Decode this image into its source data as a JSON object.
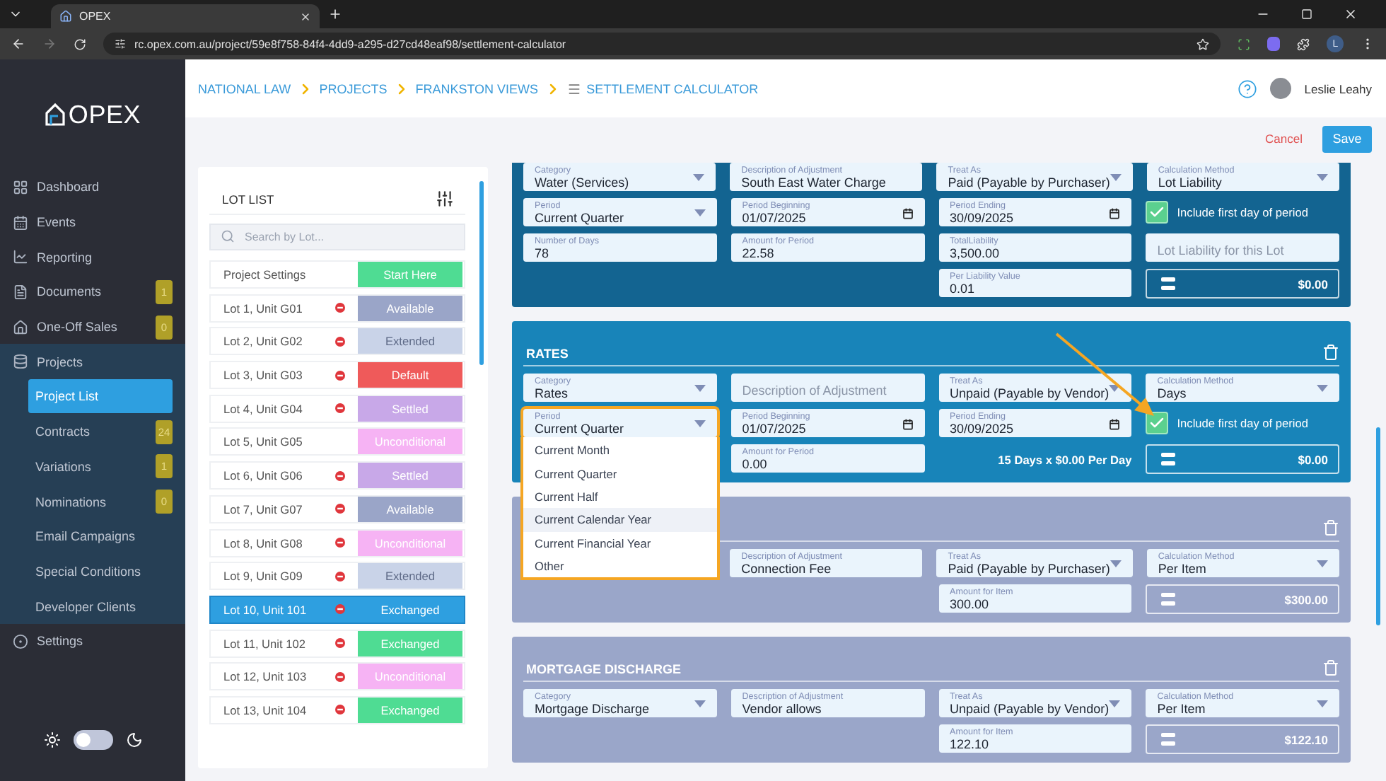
{
  "browser": {
    "tab_title": "OPEX",
    "url": "rc.opex.com.au/project/59e8f758-84f4-4dd9-a295-d27cd48eaf98/settlement-calculator",
    "profile_initial": "L",
    "forward_disabled": true
  },
  "sidebar": {
    "logo": "OPEX",
    "nav": [
      {
        "label": "Dashboard"
      },
      {
        "label": "Events"
      },
      {
        "label": "Reporting"
      },
      {
        "label": "Documents",
        "badge": "1"
      },
      {
        "label": "One-Off Sales",
        "badge": "0"
      },
      {
        "label": "Projects",
        "expanded": true,
        "children": [
          {
            "label": "Project List",
            "selected": true
          },
          {
            "label": "Contracts",
            "badge": "24",
            "selected": false
          },
          {
            "label": "Variations",
            "badge": "1",
            "selected": false
          },
          {
            "label": "Nominations",
            "badge": "0",
            "selected": false
          },
          {
            "label": "Email Campaigns",
            "selected": false
          },
          {
            "label": "Special Conditions",
            "selected": false
          },
          {
            "label": "Developer Clients",
            "selected": false
          }
        ]
      },
      {
        "label": "Settings"
      }
    ],
    "dark_mode": false
  },
  "header": {
    "breadcrumb": [
      "NATIONAL LAW",
      "PROJECTS",
      "FRANKSTON VIEWS",
      "SETTLEMENT CALCULATOR"
    ],
    "user": "Leslie Leahy"
  },
  "actions": {
    "cancel": "Cancel",
    "save": "Save"
  },
  "lot_list": {
    "title": "LOT LIST",
    "search": {
      "placeholder": "Search by Lot..."
    },
    "rows": [
      {
        "label": "Project Settings",
        "status": "Start Here",
        "color": "#4fdc93",
        "removable": false,
        "selected": false
      },
      {
        "label": "Lot 1, Unit G01",
        "status": "Available",
        "color": "#9aa5c8",
        "removable": true,
        "selected": false
      },
      {
        "label": "Lot 2, Unit G02",
        "status": "Extended",
        "color": "#c9d3e8",
        "removable": true,
        "selected": false
      },
      {
        "label": "Lot 3, Unit G03",
        "status": "Default",
        "color": "#ef5a5a",
        "removable": true,
        "selected": false
      },
      {
        "label": "Lot 4, Unit G04",
        "status": "Settled",
        "color": "#c8a8e8",
        "removable": true,
        "selected": false
      },
      {
        "label": "Lot 5, Unit G05",
        "status": "Unconditional",
        "color": "#f6b3f4",
        "removable": false,
        "selected": false
      },
      {
        "label": "Lot 6, Unit G06",
        "status": "Settled",
        "color": "#c8a8e8",
        "removable": true,
        "selected": false
      },
      {
        "label": "Lot 7, Unit G07",
        "status": "Available",
        "color": "#9aa5c8",
        "removable": true,
        "selected": false
      },
      {
        "label": "Lot 8, Unit G08",
        "status": "Unconditional",
        "color": "#f6b3f4",
        "removable": true,
        "selected": false
      },
      {
        "label": "Lot 9, Unit G09",
        "status": "Extended",
        "color": "#c9d3e8",
        "removable": true,
        "selected": false
      },
      {
        "label": "Lot 10, Unit 101",
        "status": "Exchanged",
        "color": "#2e9fe0",
        "removable": true,
        "selected": true
      },
      {
        "label": "Lot 11, Unit 102",
        "status": "Exchanged",
        "color": "#4fdc93",
        "removable": true,
        "selected": false
      },
      {
        "label": "Lot 12, Unit 103",
        "status": "Unconditional",
        "color": "#f6b3f4",
        "removable": true,
        "selected": false
      },
      {
        "label": "Lot 13, Unit 104",
        "status": "Exchanged",
        "color": "#4fdc93",
        "removable": true,
        "selected": false
      }
    ]
  },
  "panels": [
    {
      "color": "#136491",
      "deletable": false,
      "rows": [
        [
          {
            "kind": "select",
            "label": "Category",
            "value": "Water (Services)",
            "expanded": false
          },
          {
            "kind": "text",
            "label": "Description of Adjustment",
            "value": "South East Water Charge"
          },
          {
            "kind": "select",
            "label": "Treat As",
            "value": "Paid (Payable by Purchaser)",
            "expanded": false
          },
          {
            "kind": "select",
            "label": "Calculation Method",
            "value": "Lot Liability",
            "expanded": false
          }
        ],
        [
          {
            "kind": "select",
            "label": "Period",
            "value": "Current Quarter",
            "expanded": false
          },
          {
            "kind": "date",
            "label": "Period Beginning",
            "value": "01/07/2025"
          },
          {
            "kind": "date",
            "label": "Period Ending",
            "value": "30/09/2025"
          },
          {
            "kind": "checkbox",
            "label": "Include first day of period",
            "checked": true
          }
        ],
        [
          {
            "kind": "text",
            "label": "Number of Days",
            "value": "78"
          },
          {
            "kind": "text",
            "label": "Amount for Period",
            "value": "22.58"
          },
          {
            "kind": "text",
            "label": "TotalLiability",
            "value": "3,500.00"
          },
          {
            "kind": "placeholder",
            "placeholder": "Lot Liability for this Lot"
          }
        ],
        [
          "",
          "",
          {
            "kind": "text",
            "label": "Per Liability Value",
            "value": "0.01"
          },
          {
            "kind": "total",
            "value": "$0.00"
          }
        ]
      ]
    },
    {
      "color": "#1884b9",
      "title": "RATES",
      "deletable": true,
      "rows": [
        [
          {
            "kind": "select",
            "label": "Category",
            "value": "Rates",
            "expanded": false
          },
          {
            "kind": "placeholder",
            "placeholder": "Description of Adjustment"
          },
          {
            "kind": "select",
            "label": "Treat As",
            "value": "Unpaid (Payable by Vendor)",
            "expanded": false
          },
          {
            "kind": "select",
            "label": "Calculation Method",
            "value": "Days",
            "expanded": false
          }
        ],
        [
          {
            "kind": "select",
            "label": "Period",
            "value": "Current Quarter",
            "expanded": true,
            "options": [
              {
                "label": "Current Month",
                "highlighted": false
              },
              {
                "label": "Current Quarter",
                "highlighted": false
              },
              {
                "label": "Current Half",
                "highlighted": false
              },
              {
                "label": "Current Calendar Year",
                "highlighted": true
              },
              {
                "label": "Current Financial Year",
                "highlighted": false
              },
              {
                "label": "Other",
                "highlighted": false
              }
            ]
          },
          {
            "kind": "date",
            "label": "Period Beginning",
            "value": "01/07/2025"
          },
          {
            "kind": "date",
            "label": "Period Ending",
            "value": "30/09/2025"
          },
          {
            "kind": "checkbox",
            "label": "Include first day of period",
            "checked": true
          }
        ],
        [
          "",
          {
            "kind": "text",
            "label": "Amount for Period",
            "value": "0.00"
          },
          {
            "kind": "note",
            "text": "15 Days x $0.00 Per Day"
          },
          {
            "kind": "total",
            "value": "$0.00"
          }
        ]
      ]
    },
    {
      "color": "#9aa6c9",
      "deletable": true,
      "rows": [
        [
          "",
          {
            "kind": "text",
            "label": "Description of Adjustment",
            "value": "Connection Fee"
          },
          {
            "kind": "select",
            "label": "Treat As",
            "value": "Paid (Payable by Purchaser)",
            "expanded": false
          },
          {
            "kind": "select",
            "label": "Calculation Method",
            "value": "Per Item",
            "expanded": false
          }
        ],
        [
          "",
          "",
          {
            "kind": "text",
            "label": "Amount for Item",
            "value": "300.00"
          },
          {
            "kind": "total",
            "value": "$300.00"
          }
        ]
      ]
    },
    {
      "color": "#9aa6c9",
      "title": "MORTGAGE DISCHARGE",
      "deletable": true,
      "rows": [
        [
          {
            "kind": "select",
            "label": "Category",
            "value": "Mortgage Discharge",
            "expanded": false
          },
          {
            "kind": "text",
            "label": "Description of Adjustment",
            "value": "Vendor allows"
          },
          {
            "kind": "select",
            "label": "Treat As",
            "value": "Unpaid (Payable by Vendor)",
            "expanded": false
          },
          {
            "kind": "select",
            "label": "Calculation Method",
            "value": "Per Item",
            "expanded": false
          }
        ],
        [
          "",
          "",
          {
            "kind": "text",
            "label": "Amount for Item",
            "value": "122.10"
          },
          {
            "kind": "total",
            "value": "$122.10"
          }
        ]
      ]
    }
  ]
}
